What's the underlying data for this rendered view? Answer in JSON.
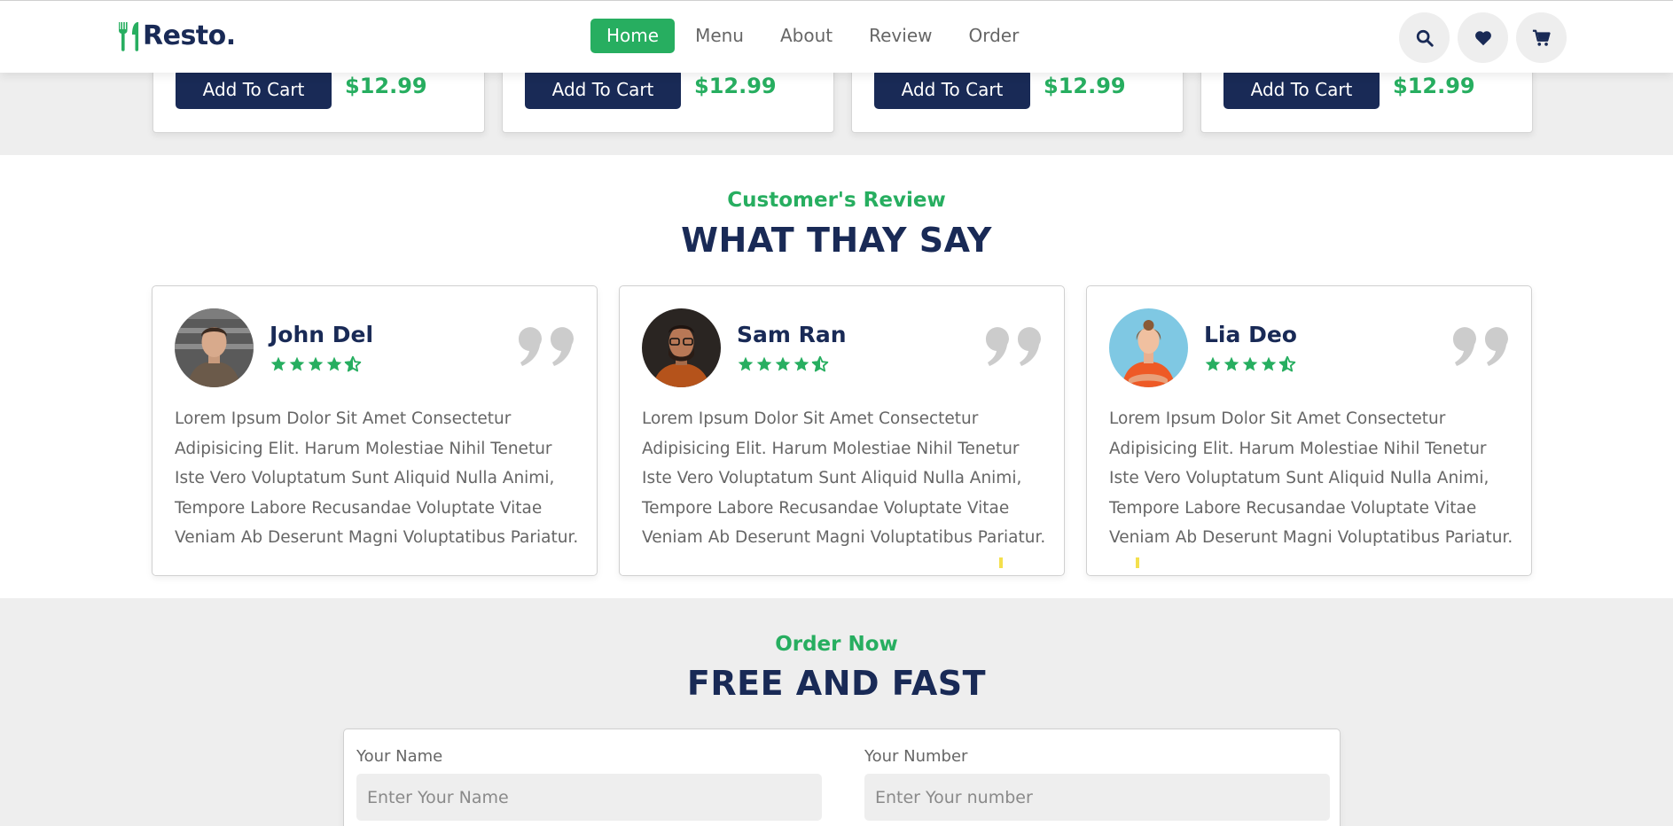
{
  "header": {
    "logo_text": "Resto.",
    "nav": [
      {
        "label": "Home",
        "active": true
      },
      {
        "label": "Menu",
        "active": false
      },
      {
        "label": "About",
        "active": false
      },
      {
        "label": "Review",
        "active": false
      },
      {
        "label": "Order",
        "active": false
      }
    ],
    "icons": [
      "search-icon",
      "heart-icon",
      "cart-icon"
    ]
  },
  "dishes": [
    {
      "button_label": "Add To Cart",
      "price": "$12.99"
    },
    {
      "button_label": "Add To Cart",
      "price": "$12.99"
    },
    {
      "button_label": "Add To Cart",
      "price": "$12.99"
    },
    {
      "button_label": "Add To Cart",
      "price": "$12.99"
    }
  ],
  "review_section": {
    "sub_heading": "Customer's Review",
    "heading": "WHAT THAY SAY",
    "reviews": [
      {
        "name": "John Del",
        "rating": 4.5,
        "text": "Lorem Ipsum Dolor Sit Amet Consectetur Adipisicing Elit. Harum Molestiae Nihil Tenetur Iste Vero Voluptatum Sunt Aliquid Nulla Animi, Tempore Labore Recusandae Voluptate Vitae Veniam Ab Deserunt Magni Voluptatibus Pariatur."
      },
      {
        "name": "Sam Ran",
        "rating": 4.5,
        "text": "Lorem Ipsum Dolor Sit Amet Consectetur Adipisicing Elit. Harum Molestiae Nihil Tenetur Iste Vero Voluptatum Sunt Aliquid Nulla Animi, Tempore Labore Recusandae Voluptate Vitae Veniam Ab Deserunt Magni Voluptatibus Pariatur."
      },
      {
        "name": "Lia Deo",
        "rating": 4.5,
        "text": "Lorem Ipsum Dolor Sit Amet Consectetur Adipisicing Elit. Harum Molestiae Nihil Tenetur Iste Vero Voluptatum Sunt Aliquid Nulla Animi, Tempore Labore Recusandae Voluptate Vitae Veniam Ab Deserunt Magni Voluptatibus Pariatur."
      }
    ]
  },
  "order_section": {
    "sub_heading": "Order Now",
    "heading": "FREE AND FAST",
    "fields": [
      {
        "label": "Your Name",
        "placeholder": "Enter Your Name",
        "value": ""
      },
      {
        "label": "Your Number",
        "placeholder": "Enter Your number",
        "value": ""
      }
    ]
  },
  "colors": {
    "accent": "#27ae60",
    "dark": "#192a56",
    "text_muted": "#666666",
    "band": "#eeeeee"
  }
}
